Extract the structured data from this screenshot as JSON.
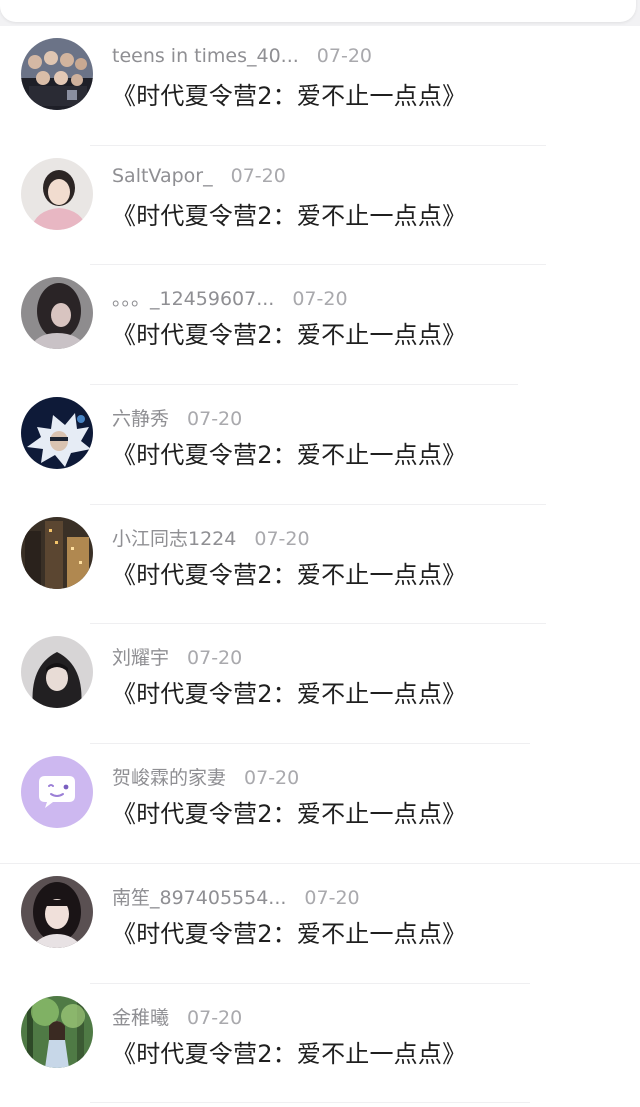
{
  "header": {
    "back_icon": "back-arrow-icon",
    "accent": "#2e7bf6"
  },
  "messages": [
    {
      "name": "teens in times_40...",
      "date": "07-20",
      "text": "《时代夏令营2：爱不止一点点》",
      "avatar": "group-photo-avatar"
    },
    {
      "name": "SaltVapor_",
      "date": "07-20",
      "text": "《时代夏令营2：爱不止一点点》",
      "avatar": "person-pink-avatar"
    },
    {
      "name": "。。。_12459607...",
      "date": "07-20",
      "text": "《时代夏令营2：爱不止一点点》",
      "avatar": "person-dark-hair-avatar"
    },
    {
      "name": "六静秀",
      "date": "07-20",
      "text": "《时代夏令营2：爱不止一点点》",
      "avatar": "anime-avatar"
    },
    {
      "name": "小江同志1224",
      "date": "07-20",
      "text": "《时代夏令营2：爱不止一点点》",
      "avatar": "city-avatar"
    },
    {
      "name": "刘耀宇",
      "date": "07-20",
      "text": "《时代夏令营2：爱不止一点点》",
      "avatar": "hooded-person-avatar"
    },
    {
      "name": "贺峻霖的家妻",
      "date": "07-20",
      "text": "《时代夏令营2：爱不止一点点》",
      "avatar": "default-chat-bubble-avatar"
    },
    {
      "name": "南笙_897405554...",
      "date": "07-20",
      "text": "《时代夏令营2：爱不止一点点》",
      "avatar": "girl-portrait-avatar"
    },
    {
      "name": "金稚曦",
      "date": "07-20",
      "text": "《时代夏令营2：爱不止一点点》",
      "avatar": "forest-girl-avatar"
    }
  ]
}
